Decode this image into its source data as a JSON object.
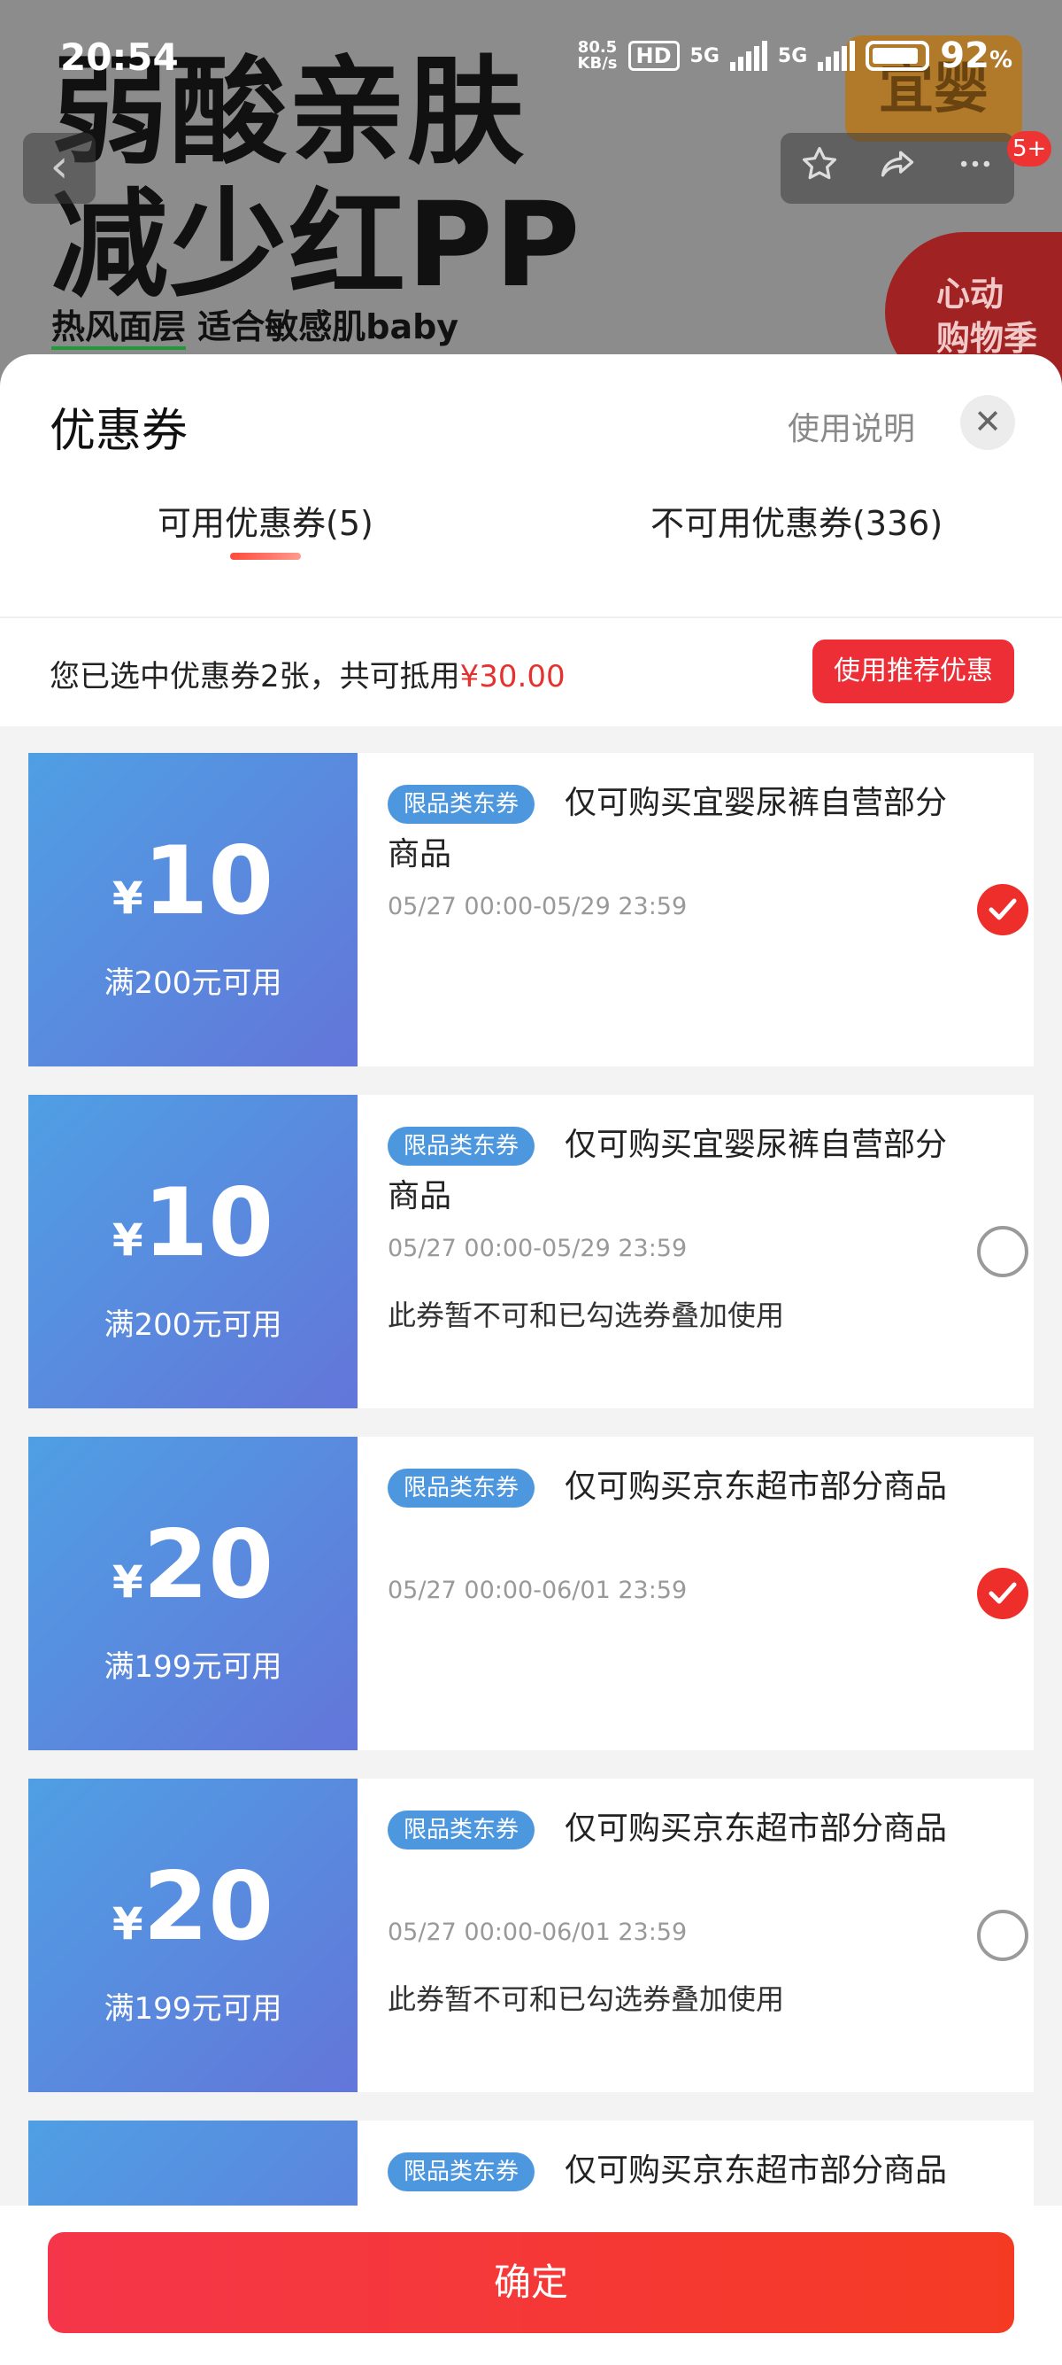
{
  "status_bar": {
    "time": "20:54",
    "net_speed_value": "80.5",
    "net_speed_unit": "KB/s",
    "hd_label": "HD",
    "sim1": "5G",
    "sim2": "5G",
    "battery": "92",
    "battery_unit": "%"
  },
  "background": {
    "headline_line1": "弱酸亲肤",
    "headline_line2": "减少红PP",
    "sub_part1": "热风面层",
    "sub_part2": "适合敏感肌baby",
    "brand": "宜婴",
    "promo_line1": "心动",
    "promo_line2": "购物季",
    "badge": "5+",
    "icons": [
      "back-icon",
      "star-icon",
      "share-icon",
      "more-icon"
    ]
  },
  "sheet": {
    "title": "优惠券",
    "help": "使用说明",
    "close_glyph": "✕"
  },
  "tabs": [
    {
      "label": "可用优惠券(5)",
      "active": true
    },
    {
      "label": "不可用优惠券(336)",
      "active": false
    }
  ],
  "summary": {
    "text": "您已选中优惠券2张，共可抵用",
    "amount": "¥30.00",
    "button": "使用推荐优惠"
  },
  "coupons": [
    {
      "currency": "¥",
      "amount": "10",
      "threshold": "满200元可用",
      "tag": "限品类东券",
      "desc": "仅可购买宜婴尿裤自营部分商品",
      "validity": "05/27 00:00-05/29 23:59",
      "note": "",
      "checked": true
    },
    {
      "currency": "¥",
      "amount": "10",
      "threshold": "满200元可用",
      "tag": "限品类东券",
      "desc": "仅可购买宜婴尿裤自营部分商品",
      "validity": "05/27 00:00-05/29 23:59",
      "note": "此券暂不可和已勾选券叠加使用",
      "checked": false
    },
    {
      "currency": "¥",
      "amount": "20",
      "threshold": "满199元可用",
      "tag": "限品类东券",
      "desc": "仅可购买京东超市部分商品",
      "validity": "05/27 00:00-06/01 23:59",
      "note": "",
      "checked": true
    },
    {
      "currency": "¥",
      "amount": "20",
      "threshold": "满199元可用",
      "tag": "限品类东券",
      "desc": "仅可购买京东超市部分商品",
      "validity": "05/27 00:00-06/01 23:59",
      "note": "此券暂不可和已勾选券叠加使用",
      "checked": false
    },
    {
      "currency": "",
      "amount": "",
      "threshold": "",
      "tag": "限品类东券",
      "desc": "仅可购买京东超市部分商品",
      "validity": "",
      "note": "",
      "checked": false
    }
  ],
  "footer": {
    "confirm": "确定"
  },
  "colors": {
    "accent_red": "#ee2e36",
    "coupon_blue_start": "#4f9fe4",
    "coupon_blue_end": "#6376d9",
    "tag_blue": "#4d97df"
  }
}
